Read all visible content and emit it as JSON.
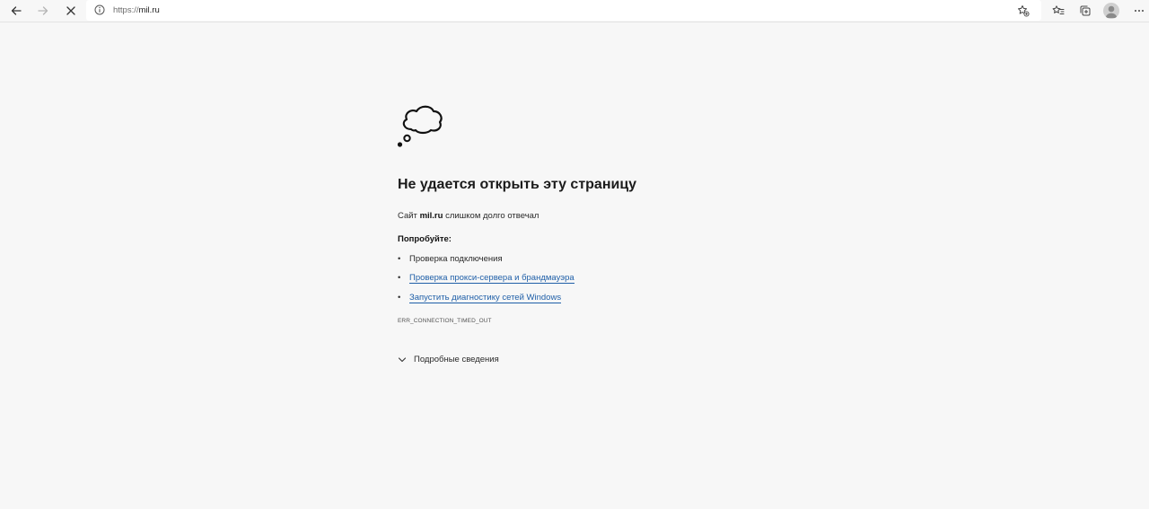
{
  "browser": {
    "address_scheme": "https://",
    "address_host": "mil.ru",
    "icons": {
      "back": "back-arrow-icon",
      "forward": "forward-arrow-icon",
      "stop": "close-icon",
      "site_info": "info-icon",
      "add_favorite": "star-plus-icon",
      "favorites": "favorites-icon",
      "collections": "collections-icon",
      "profile": "avatar",
      "menu": "more-icon"
    }
  },
  "error": {
    "title": "Не удается открыть эту страницу",
    "message_prefix": "Сайт",
    "message_host": "mil.ru",
    "message_suffix": "слишком долго отвечал",
    "try_label": "Попробуйте:",
    "suggestions": [
      {
        "text": "Проверка подключения",
        "link": false
      },
      {
        "text": "Проверка прокси-сервера и брандмауэра",
        "link": true
      },
      {
        "text": "Запустить диагностику сетей Windows",
        "link": true
      }
    ],
    "error_code": "ERR_CONNECTION_TIMED_OUT",
    "details_label": "Подробные сведения"
  },
  "colors": {
    "background": "#f7f7f7",
    "link": "#1f5fa8",
    "text": "#1a1a1a"
  }
}
